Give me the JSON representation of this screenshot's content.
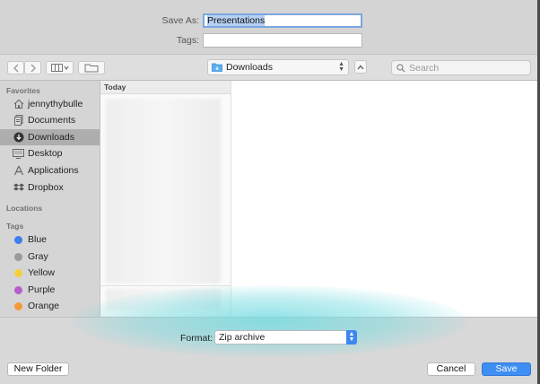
{
  "save_as": {
    "label": "Save As:",
    "value": "Presentations"
  },
  "tags": {
    "label": "Tags:",
    "value": ""
  },
  "toolbar": {
    "location": "Downloads",
    "search_placeholder": "Search"
  },
  "sidebar": {
    "favorites_header": "Favorites",
    "favorites": [
      {
        "label": "jennythybulle",
        "icon": "home-icon"
      },
      {
        "label": "Documents",
        "icon": "documents-icon"
      },
      {
        "label": "Downloads",
        "icon": "downloads-icon",
        "active": true
      },
      {
        "label": "Desktop",
        "icon": "desktop-icon"
      },
      {
        "label": "Applications",
        "icon": "applications-icon"
      },
      {
        "label": "Dropbox",
        "icon": "dropbox-icon"
      }
    ],
    "locations_header": "Locations",
    "tags_header": "Tags",
    "tags": [
      {
        "label": "Blue",
        "color": "#3d7ff0"
      },
      {
        "label": "Gray",
        "color": "#9a9a9a"
      },
      {
        "label": "Yellow",
        "color": "#f6cf3e"
      },
      {
        "label": "Purple",
        "color": "#b35fcf"
      },
      {
        "label": "Orange",
        "color": "#f59a3a"
      }
    ]
  },
  "browser": {
    "column_header": "Today"
  },
  "footer": {
    "format_label": "Format:",
    "format_value": "Zip archive",
    "new_folder": "New Folder",
    "cancel": "Cancel",
    "save": "Save"
  }
}
